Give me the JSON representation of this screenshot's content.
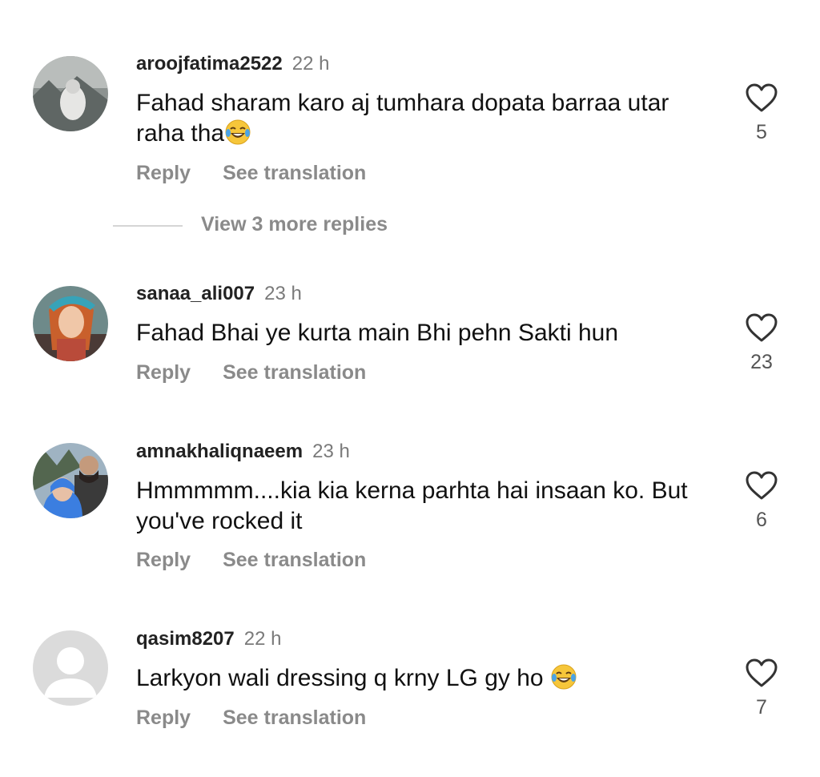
{
  "comments": [
    {
      "username": "aroojfatima2522",
      "time": "22 h",
      "text": "Fahad sharam karo aj tumhara dopata barraa utar raha tha",
      "likes": "5",
      "reply_label": "Reply",
      "translate_label": "See translation"
    },
    {
      "username": "sanaa_ali007",
      "time": "23 h",
      "text": "Fahad Bhai ye kurta main Bhi pehn Sakti hun",
      "likes": "23",
      "reply_label": "Reply",
      "translate_label": "See translation"
    },
    {
      "username": "amnakhaliqnaeem",
      "time": "23 h",
      "text": "Hmmmmm....kia kia kerna parhta hai insaan ko. But you've rocked it",
      "likes": "6",
      "reply_label": "Reply",
      "translate_label": "See translation"
    },
    {
      "username": "qasim8207",
      "time": "22 h",
      "text": "Larkyon wali dressing q krny LG gy ho ",
      "likes": "7",
      "reply_label": "Reply",
      "translate_label": "See translation"
    }
  ],
  "view_replies": {
    "label": "View 3 more replies"
  },
  "icons": {
    "like": "heart-outline-icon",
    "emoji": "face-with-tears-of-joy-icon"
  },
  "colors": {
    "username": "#222222",
    "secondary": "#8a8a8a",
    "line": "#d5d5d5"
  }
}
